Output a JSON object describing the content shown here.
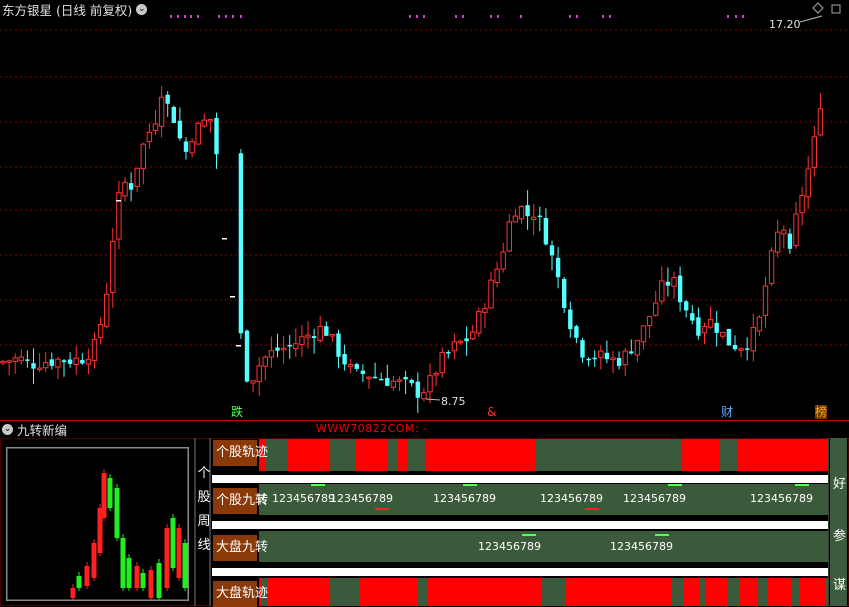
{
  "main": {
    "stock_name": "东方银星",
    "period_label": "(日线 前复权)",
    "high_marker": "17.20",
    "low_marker": "8.75",
    "tags": [
      {
        "text": "跌",
        "color": "#55ff55"
      },
      {
        "text": "&",
        "color": "#ff3333"
      },
      {
        "text": "财",
        "color": "#66aaff"
      },
      {
        "text": "榜",
        "color": "#ffaa00"
      }
    ],
    "colors": {
      "up": "#ff3232",
      "down": "#54ffff",
      "grid": "#8b0000"
    }
  },
  "sub": {
    "title": "九转新编",
    "watermark": "WWW70822COM: -",
    "left_vertical_text": [
      "个",
      "股",
      "周",
      "线"
    ],
    "rows": [
      {
        "label": "个股轨迹"
      },
      {
        "label": "个股九转"
      },
      {
        "label": "大盘九转"
      },
      {
        "label": "大盘轨迹"
      }
    ],
    "row2_prefix": "转",
    "seq": "123456789",
    "right_vertical_text": [
      "好",
      "参",
      "谋"
    ]
  },
  "chart_data": {
    "type": "candlestick",
    "y_extremes": {
      "high": 17.2,
      "low": 8.75
    }
  }
}
